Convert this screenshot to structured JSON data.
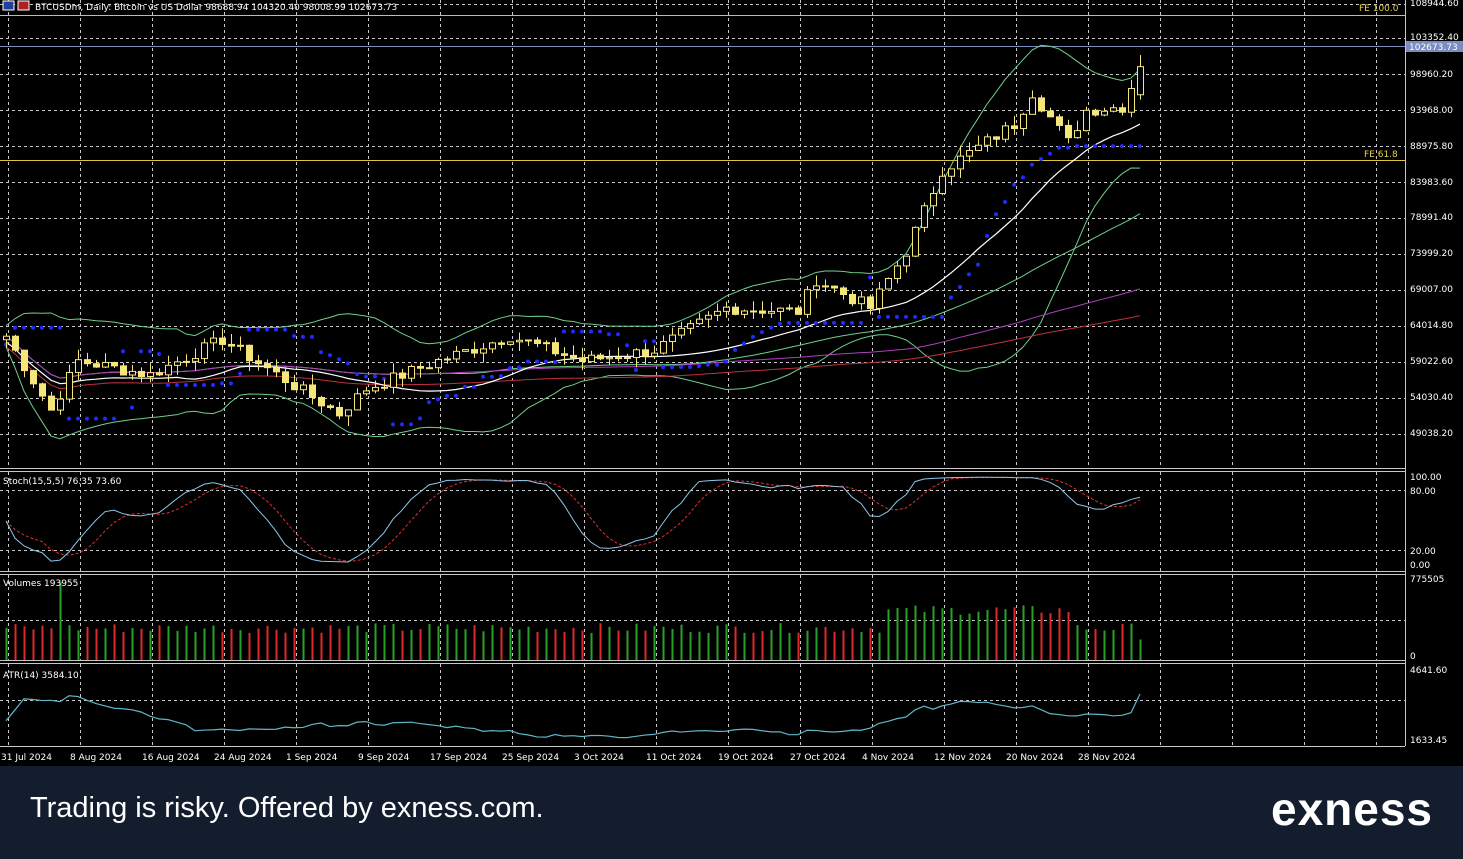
{
  "header": {
    "title": "BTCUSDm, Daily:  Bitcoin vs US Dollar  98688.94 104320.40 98008.99 102673.73"
  },
  "colors": {
    "background": "#000000",
    "grid": "#c8c8c8",
    "bull_candle": "#f5e67a",
    "bear_candle": "#f5e67a",
    "price_line": "#7a8cc0",
    "fib_line": "#d9c43a",
    "sar": "#1f2bff",
    "bollinger": "#6fcf8a",
    "ma_white": "#ffffff",
    "ma_green": "#6fcf8a",
    "ma_purple": "#b040c0",
    "ma_red": "#c03040",
    "stoch_main": "#8ec7e8",
    "stoch_signal": "#e03030",
    "vol_up": "#2aa02a",
    "vol_down": "#e02a2a",
    "atr": "#5fb6c8",
    "footer_bg": "#141d2e"
  },
  "main_axis": {
    "labels": [
      "108944.60",
      "103352.40",
      "98960.20",
      "93968.00",
      "88975.80",
      "83983.60",
      "78991.40",
      "73999.20",
      "69007.00",
      "64014.80",
      "59022.60",
      "54030.40",
      "49038.20"
    ],
    "current_price": "102673.73",
    "fib_labels": [
      "FE 100.0",
      "FE 61.8"
    ]
  },
  "date_labels": [
    "31 Jul 2024",
    "8 Aug 2024",
    "16 Aug 2024",
    "24 Aug 2024",
    "1 Sep 2024",
    "9 Sep 2024",
    "17 Sep 2024",
    "25 Sep 2024",
    "3 Oct 2024",
    "11 Oct 2024",
    "19 Oct 2024",
    "27 Oct 2024",
    "4 Nov 2024",
    "12 Nov 2024",
    "20 Nov 2024",
    "28 Nov 2024"
  ],
  "stoch": {
    "label": "Stoch(15,5,5) 76.35 73.60",
    "axis": [
      "100.00",
      "80.00",
      "20.00",
      "0.00"
    ]
  },
  "volumes": {
    "label": "Volumes 193955",
    "axis": [
      "775505",
      "0"
    ]
  },
  "atr": {
    "label": "ATR(14) 3584.10",
    "axis": [
      "4641.60",
      "1633.45"
    ]
  },
  "chart_data": {
    "type": "candlestick",
    "title": "BTCUSDm, Daily:  Bitcoin vs US Dollar",
    "ohlc_last": {
      "open": 98688.94,
      "high": 104320.4,
      "low": 98008.99,
      "close": 102673.73
    },
    "y_range": [
      45000,
      109000
    ],
    "close_keypoints": [
      {
        "date": "31 Jul 2024",
        "close": 64500
      },
      {
        "date": "5 Aug 2024",
        "close": 54000
      },
      {
        "date": "8 Aug 2024",
        "close": 61000
      },
      {
        "date": "16 Aug 2024",
        "close": 59000
      },
      {
        "date": "24 Aug 2024",
        "close": 64000
      },
      {
        "date": "1 Sep 2024",
        "close": 57500
      },
      {
        "date": "6 Sep 2024",
        "close": 53500
      },
      {
        "date": "9 Sep 2024",
        "close": 57000
      },
      {
        "date": "17 Sep 2024",
        "close": 61000
      },
      {
        "date": "25 Sep 2024",
        "close": 64500
      },
      {
        "date": "3 Oct 2024",
        "close": 61000
      },
      {
        "date": "11 Oct 2024",
        "close": 62500
      },
      {
        "date": "19 Oct 2024",
        "close": 68500
      },
      {
        "date": "27 Oct 2024",
        "close": 68000
      },
      {
        "date": "29 Oct 2024",
        "close": 72500
      },
      {
        "date": "4 Nov 2024",
        "close": 68500
      },
      {
        "date": "8 Nov 2024",
        "close": 76500
      },
      {
        "date": "12 Nov 2024",
        "close": 88000
      },
      {
        "date": "20 Nov 2024",
        "close": 94500
      },
      {
        "date": "22 Nov 2024",
        "close": 99000
      },
      {
        "date": "26 Nov 2024",
        "close": 92000
      },
      {
        "date": "28 Nov 2024",
        "close": 96500
      },
      {
        "date": "2 Dec 2024",
        "close": 97000
      },
      {
        "date": "4 Dec 2024",
        "close": 102673.73
      }
    ],
    "fib_levels": [
      {
        "name": "FE 100.0",
        "value": 106300
      },
      {
        "name": "FE 61.8",
        "value": 86800
      }
    ],
    "stoch_range": [
      0,
      100
    ],
    "stoch_levels": [
      80,
      20
    ],
    "stoch_last": {
      "main": 76.35,
      "signal": 73.6
    },
    "volume_range": [
      0,
      775505
    ],
    "volume_last": 193955,
    "atr_range": [
      1633.45,
      4641.6
    ],
    "atr_last": 3584.1
  },
  "footer": {
    "disclaimer": "Trading is risky. Offered by exness.com.",
    "brand": "exness"
  }
}
